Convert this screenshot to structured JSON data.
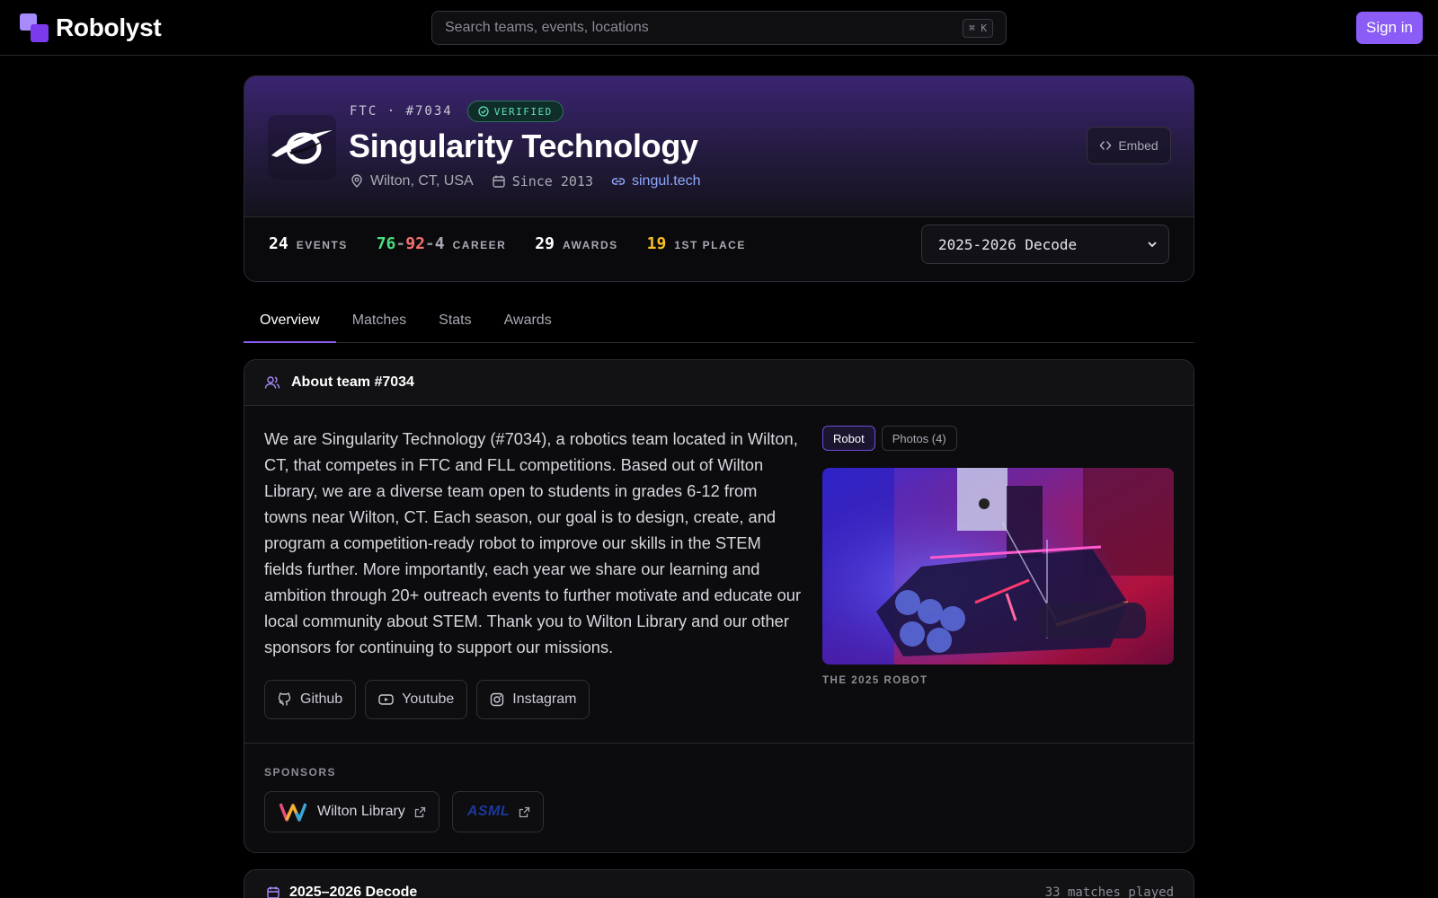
{
  "app": {
    "name": "Robolyst"
  },
  "search": {
    "placeholder": "Search teams, events, locations",
    "shortcut": "⌘ K"
  },
  "header": {
    "signin_label": "Sign in"
  },
  "team": {
    "kicker": "FTC · #7034",
    "verified_label": "VERIFIED",
    "name": "Singularity Technology",
    "location": "Wilton, CT, USA",
    "since": "Since 2013",
    "website": "singul.tech",
    "embed_label": "Embed"
  },
  "stats": {
    "events": {
      "value": "24",
      "label": "EVENTS"
    },
    "career": {
      "wins": "76",
      "losses": "92",
      "ties": "4",
      "label": "CAREER"
    },
    "awards": {
      "value": "29",
      "label": "AWARDS"
    },
    "first_place": {
      "value": "19",
      "label": "1ST PLACE"
    }
  },
  "season_select": {
    "selected": "2025-2026 Decode"
  },
  "tabs": [
    {
      "label": "Overview",
      "active": true
    },
    {
      "label": "Matches",
      "active": false
    },
    {
      "label": "Stats",
      "active": false
    },
    {
      "label": "Awards",
      "active": false
    }
  ],
  "about": {
    "title": "About team #7034",
    "bio": "We are Singularity Technology (#7034), a robotics team located in Wilton, CT, that competes in FTC and FLL competitions. Based out of Wilton Library, we are a diverse team open to students in grades 6-12 from towns near Wilton, CT. Each season, our goal is to design, create, and program a competition-ready robot to improve our skills in the STEM fields further. More importantly, each year we share our learning and ambition through 20+ outreach events to further motivate and educate our local community about STEM. Thank you to Wilton Library and our other sponsors for continuing to support our missions.",
    "socials": [
      {
        "label": "Github",
        "icon": "github-icon"
      },
      {
        "label": "Youtube",
        "icon": "youtube-icon"
      },
      {
        "label": "Instagram",
        "icon": "instagram-icon"
      }
    ],
    "media_tabs": [
      {
        "label": "Robot",
        "active": true
      },
      {
        "label": "Photos (4)",
        "active": false
      }
    ],
    "caption": "THE 2025 ROBOT",
    "sponsors_label": "SPONSORS",
    "sponsors": [
      {
        "label": "Wilton Library"
      },
      {
        "label": "ASML"
      }
    ]
  },
  "season_card": {
    "title": "2025–2026 Decode",
    "matches": "33 matches played"
  },
  "colors": {
    "accent": "#8b5cf6",
    "win": "#4ade80",
    "loss": "#f87171",
    "gold": "#fbbf24",
    "verified": "#5ee0b0"
  }
}
